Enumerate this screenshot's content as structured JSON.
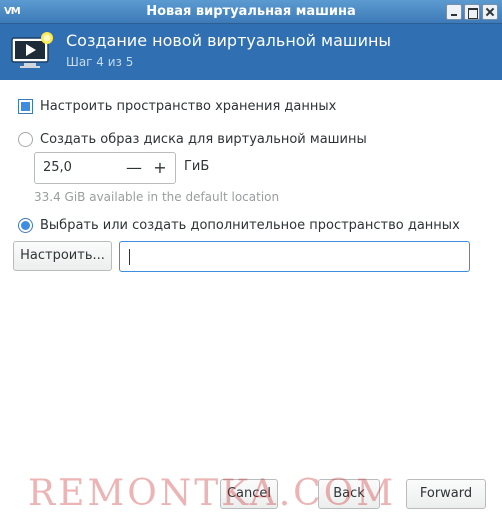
{
  "window": {
    "title": "Новая виртуальная машина",
    "app_icon_text": "VM"
  },
  "header": {
    "title": "Создание новой виртуальной машины",
    "step": "Шаг 4 из 5"
  },
  "storage": {
    "enable_label": "Настроить пространство хранения данных",
    "enable_checked": true,
    "create_image_label": "Создать образ диска для виртуальной машины",
    "create_image_checked": false,
    "size_value": "25,0",
    "size_minus": "—",
    "size_plus": "+",
    "size_unit": "ГиБ",
    "available_hint": "33.4 GiB available in the default location",
    "select_custom_label": "Выбрать или создать дополнительное пространство данных",
    "select_custom_checked": true,
    "manage_button": "Настроить...",
    "path_value": ""
  },
  "footer": {
    "cancel": "Cancel",
    "back": "Back",
    "forward": "Forward"
  },
  "watermark": "REMONTKA.COM",
  "colors": {
    "header_bg": "#2f6fb2",
    "accent": "#3d8ee0"
  }
}
